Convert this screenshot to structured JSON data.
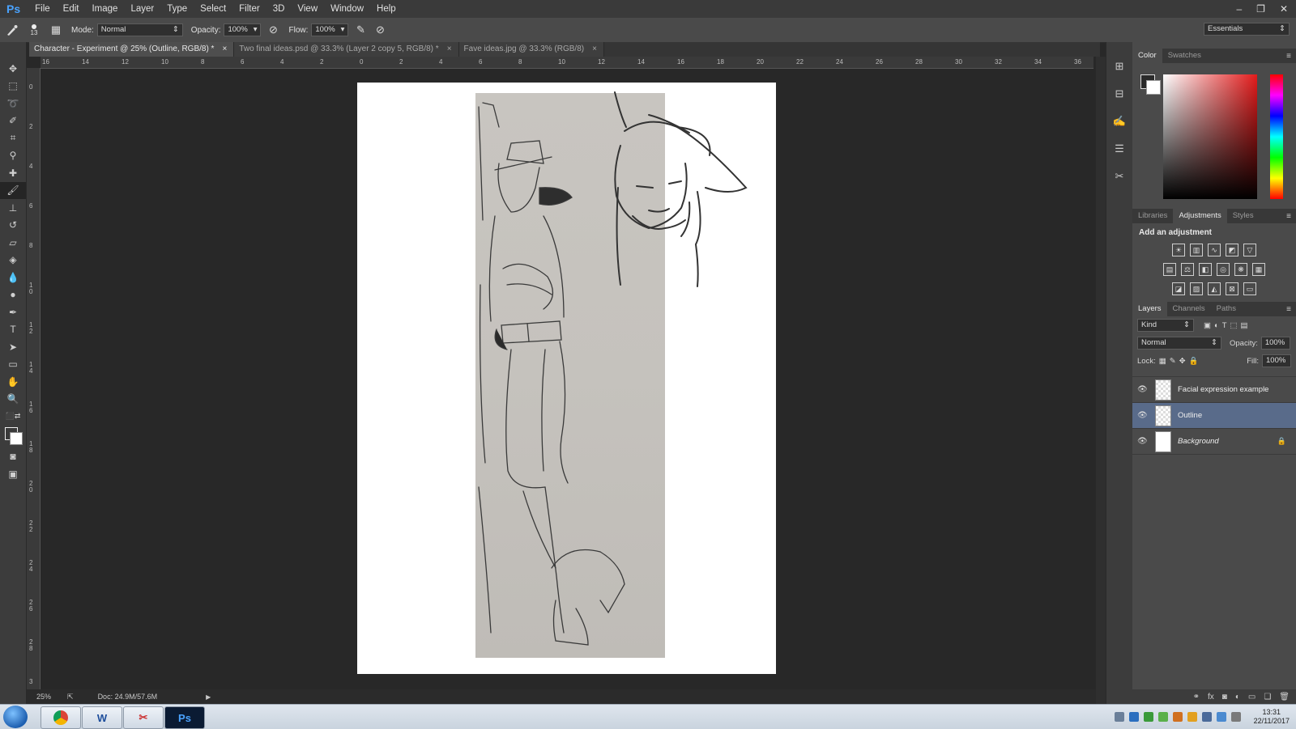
{
  "app": {
    "logo": "Ps"
  },
  "menu": [
    "File",
    "Edit",
    "Image",
    "Layer",
    "Type",
    "Select",
    "Filter",
    "3D",
    "View",
    "Window",
    "Help"
  ],
  "window_controls": {
    "minimize": "–",
    "restore": "❐",
    "close": "✕"
  },
  "options_bar": {
    "brush_size": "13",
    "mode_label": "Mode:",
    "mode_value": "Normal",
    "opacity_label": "Opacity:",
    "opacity_value": "100%",
    "flow_label": "Flow:",
    "flow_value": "100%",
    "workspace": "Essentials"
  },
  "tabs": [
    {
      "label": "Character - Experiment @ 25% (Outline, RGB/8) *",
      "active": true
    },
    {
      "label": "Two final ideas.psd @ 33.3% (Layer 2 copy 5, RGB/8) *",
      "active": false
    },
    {
      "label": "Fave ideas.jpg @ 33.3% (RGB/8)",
      "active": false
    }
  ],
  "tab_close": "×",
  "ruler_h": [
    "16",
    "14",
    "12",
    "10",
    "8",
    "6",
    "4",
    "2",
    "0",
    "2",
    "4",
    "6",
    "8",
    "10",
    "12",
    "14",
    "16",
    "18",
    "20",
    "22",
    "24",
    "26",
    "28",
    "30",
    "32",
    "34",
    "36"
  ],
  "ruler_v": [
    "0",
    "2",
    "4",
    "6",
    "8",
    "10",
    "12",
    "14",
    "16",
    "18",
    "20",
    "22",
    "24",
    "26",
    "28",
    "3"
  ],
  "status": {
    "zoom": "25%",
    "doc": "Doc: 24.9M/57.6M"
  },
  "color_panel": {
    "tabs": [
      "Color",
      "Swatches"
    ],
    "active": 0
  },
  "adjust_panel": {
    "tabs": [
      "Libraries",
      "Adjustments",
      "Styles"
    ],
    "active": 1,
    "title": "Add an adjustment"
  },
  "layers_panel": {
    "tabs": [
      "Layers",
      "Channels",
      "Paths"
    ],
    "active": 0,
    "filter": "Kind",
    "blend_mode": "Normal",
    "opacity_label": "Opacity:",
    "opacity_value": "100%",
    "lock_label": "Lock:",
    "fill_label": "Fill:",
    "fill_value": "100%",
    "layers": [
      {
        "name": "Facial expression example",
        "selected": false
      },
      {
        "name": "Outline",
        "selected": true
      },
      {
        "name": "Background",
        "selected": false
      }
    ]
  },
  "taskbar": {
    "word": "W",
    "ps": "Ps",
    "time": "13:31",
    "date": "22/11/2017"
  }
}
